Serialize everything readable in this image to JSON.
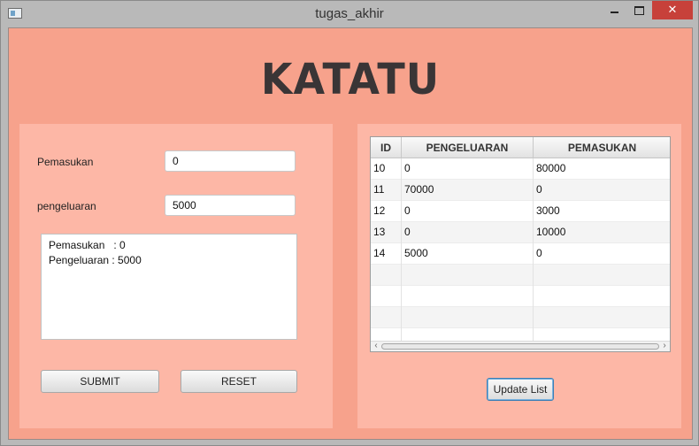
{
  "window": {
    "title": "tugas_akhir",
    "close_glyph": "✕"
  },
  "header": {
    "logo": "KATATU"
  },
  "form": {
    "pemasukan_label": "Pemasukan",
    "pemasukan_value": "0",
    "pengeluaran_label": "pengeluaran",
    "pengeluaran_value": "5000",
    "summary_text": "Pemasukan   : 0\nPengeluaran : 5000",
    "submit_label": "SUBMIT",
    "reset_label": "RESET"
  },
  "table": {
    "columns": [
      "ID",
      "PENGELUARAN",
      "PEMASUKAN"
    ],
    "rows": [
      {
        "id": "10",
        "pengeluaran": "0",
        "pemasukan": "80000"
      },
      {
        "id": "11",
        "pengeluaran": "70000",
        "pemasukan": "0"
      },
      {
        "id": "12",
        "pengeluaran": "0",
        "pemasukan": "3000"
      },
      {
        "id": "13",
        "pengeluaran": "0",
        "pemasukan": "10000"
      },
      {
        "id": "14",
        "pengeluaran": "5000",
        "pemasukan": "0"
      }
    ],
    "empty_rows": 4
  },
  "actions": {
    "update_label": "Update List"
  },
  "colors": {
    "background": "#f7a28c",
    "panel": "#fdb7a6",
    "close_button": "#c7413a"
  }
}
